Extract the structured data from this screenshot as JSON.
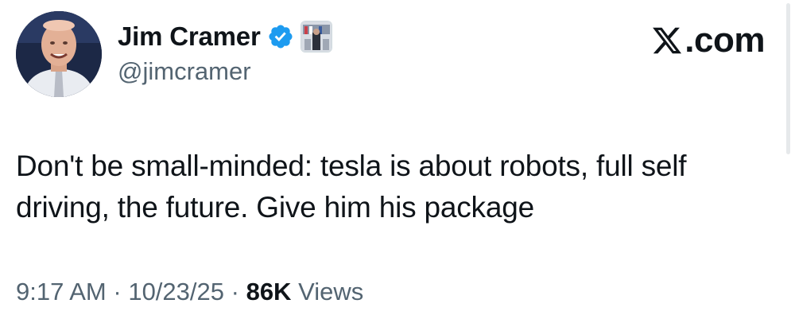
{
  "author": {
    "display_name": "Jim Cramer",
    "handle": "@jimcramer",
    "avatar_icon": "profile-photo",
    "verified_icon": "verified-badge-icon",
    "verified_color": "#1d9bf0",
    "affiliate_icon": "affiliate-badge-icon"
  },
  "site": {
    "logo_icon": "x-logo-icon",
    "domain_suffix": ".com"
  },
  "tweet": {
    "text": "Don't be small-minded: tesla is about robots, full self driving, the future. Give him his package"
  },
  "meta": {
    "time": "9:17 AM",
    "separator": "·",
    "date": "10/23/25",
    "views_count": "86K",
    "views_label": "Views"
  },
  "colors": {
    "text_primary": "#0f1419",
    "text_secondary": "#536471",
    "background": "#ffffff"
  }
}
